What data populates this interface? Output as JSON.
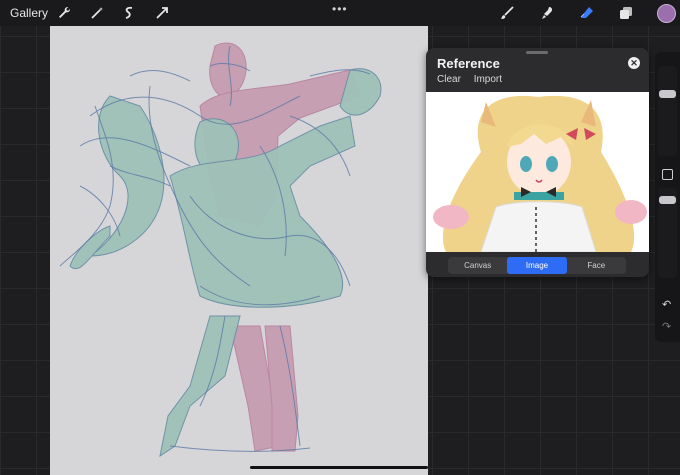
{
  "topbar": {
    "gallery_label": "Gallery",
    "left_tools": [
      "wrench-icon",
      "magic-wand-icon",
      "selection-icon",
      "transform-icon"
    ],
    "right_tools": [
      "brush-icon",
      "smudge-icon",
      "eraser-icon",
      "layers-icon"
    ],
    "more": "•••",
    "current_color": "#9b6fae",
    "active_tool_color": "#3b7cf6"
  },
  "reference": {
    "title": "Reference",
    "clear_label": "Clear",
    "import_label": "Import",
    "close_icon": "close-icon",
    "tabs": [
      {
        "label": "Canvas",
        "active": false
      },
      {
        "label": "Image",
        "active": true
      },
      {
        "label": "Face",
        "active": false
      }
    ]
  },
  "sidebar": {
    "undo_icon": "↶",
    "redo_icon": "↷"
  }
}
